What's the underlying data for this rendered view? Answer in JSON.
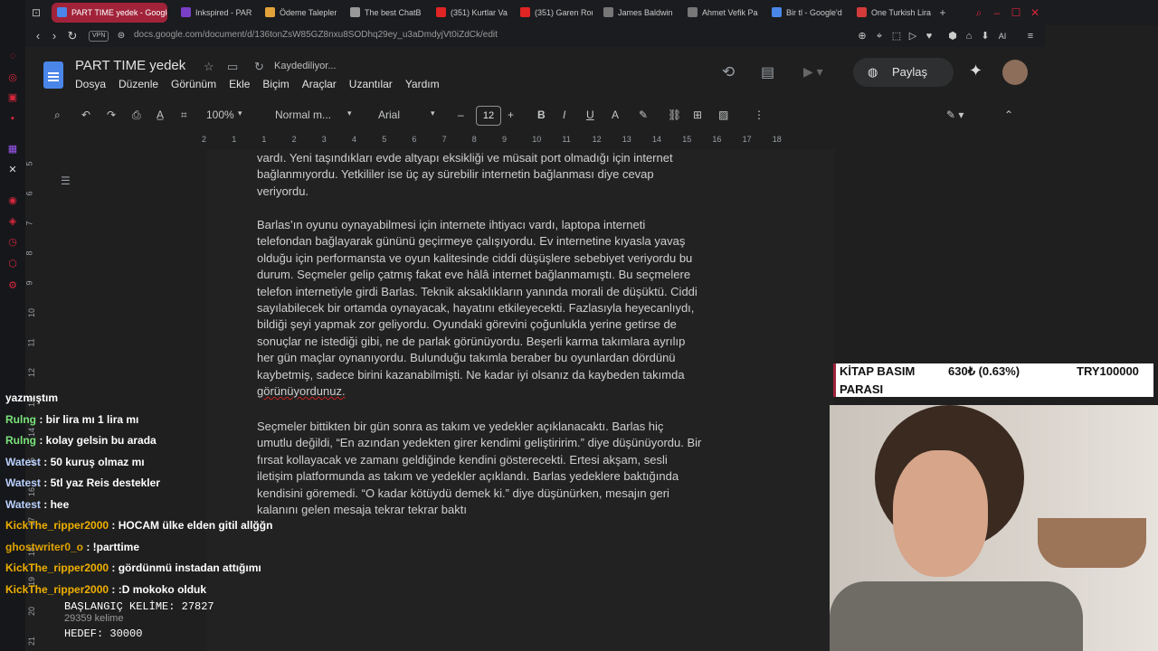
{
  "browser": {
    "tabs": [
      {
        "label": "PART TIME yedek - Google",
        "color": "#4a86e8",
        "active": true
      },
      {
        "label": "Inkspired - PAR",
        "color": "#7a3fc7",
        "active": false
      },
      {
        "label": "Ödeme Talepler",
        "color": "#e2a33a",
        "active": false
      },
      {
        "label": "The best ChatB",
        "color": "#999999",
        "active": false
      },
      {
        "label": "(351) Kurtlar Va",
        "color": "#e02424",
        "active": false
      },
      {
        "label": "(351) Garen Ron",
        "color": "#e02424",
        "active": false
      },
      {
        "label": "James Baldwin",
        "color": "#777777",
        "active": false
      },
      {
        "label": "Ahmet Vefik Pa",
        "color": "#777777",
        "active": false
      },
      {
        "label": "Bir tl - Google'd",
        "color": "#4a86e8",
        "active": false
      },
      {
        "label": "One Turkish Lira",
        "color": "#d33b3b",
        "active": false
      }
    ],
    "vpn": "VPN",
    "url": "docs.google.com/document/d/136tonZsW85GZ8nxu8SODhq29ey_u3aDmdyjVt0iZdCk/edit",
    "ai_label": "AI"
  },
  "docs": {
    "title": "PART TIME yedek",
    "saving": "Kaydediliyor...",
    "menu": [
      "Dosya",
      "Düzenle",
      "Görünüm",
      "Ekle",
      "Biçim",
      "Araçlar",
      "Uzantılar",
      "Yardım"
    ],
    "share_label": "Paylaş",
    "zoom": "100%",
    "style": "Normal m...",
    "font": "Arial",
    "font_size": "12",
    "ruler_top": [
      "2",
      "1",
      "1",
      "2",
      "3",
      "4",
      "5",
      "6",
      "7",
      "8",
      "9",
      "10",
      "11",
      "12",
      "13",
      "14",
      "15",
      "16",
      "17",
      "18"
    ],
    "ruler_left": [
      "5",
      "6",
      "7",
      "8",
      "9",
      "10",
      "11",
      "12",
      "13",
      "14",
      "15",
      "16",
      "17",
      "18",
      "19",
      "20",
      "21"
    ],
    "paragraphs": [
      [
        "vardı. Yeni taşındıkları evde altyapı eksikliği ve müsait port olmadığı için internet",
        "bağlanmıyordu. Yetkililer ise üç ay sürebilir internetin bağlanması diye cevap",
        "veriyordu."
      ],
      [
        "Barlas’ın oyunu oynayabilmesi için internete ihtiyacı vardı, laptopa interneti",
        "telefondan bağlayarak gününü geçirmeye çalışıyordu. Ev internetine kıyasla yavaş",
        "olduğu için performansta ve oyun kalitesinde ciddi düşüşlere sebebiyet veriyordu bu",
        "durum. Seçmeler gelip çatmış fakat eve hâlâ internet bağlanmamıştı. Bu seçmelere",
        "telefon internetiyle girdi Barlas. Teknik aksaklıkların yanında morali de düşüktü. Ciddi",
        "sayılabilecek bir ortamda oynayacak, hayatını etkileyecekti. Fazlasıyla heyecanlıydı,",
        "bildiği şeyi yapmak zor geliyordu. Oyundaki görevini çoğunlukla yerine getirse de",
        "sonuçlar ne istediği gibi, ne de parlak görünüyordu. Beşerli karma takımlara ayrılıp",
        "her gün maçlar oynanıyordu. Bulunduğu takımla beraber bu oyunlardan dördünü",
        "kaybetmiş, sadece birini kazanabilmişti. Ne kadar iyi olsanız da kaybeden takımda",
        "görünüyordunuz."
      ],
      [
        "Seçmeler bittikten bir gün sonra as takım ve yedekler açıklanacaktı. Barlas hiç",
        "umutlu değildi, “En azından yedekten girer kendimi geliştiririm.” diye düşünüyordu. Bir",
        "fırsat kollayacak ve zamanı geldiğinde kendini gösterecekti. Ertesi akşam, sesli",
        "iletişim platformunda as takım ve yedekler açıklandı. Barlas yedeklere baktığında",
        "kendisini göremedi. “O kadar kötüydü demek ki.” diye düşünürken, mesajın geri",
        "kalanını gelen mesaja tekrar tekrar baktı"
      ]
    ]
  },
  "chat": {
    "messages": [
      {
        "user": "",
        "text": "yazmıştım",
        "style": "plain"
      },
      {
        "user": "Rulng",
        "text": " : bir lira mı 1 lira mı",
        "style": "u1"
      },
      {
        "user": "Rulng",
        "text": " : kolay gelsin bu arada",
        "style": "u1"
      },
      {
        "user": "Watest",
        "text": " : 50 kuruş olmaz mı",
        "style": "u2"
      },
      {
        "user": "Watest",
        "text": " : 5tl yaz Reis destekler",
        "style": "u2"
      },
      {
        "user": "Watest",
        "text": " : hee",
        "style": "u2"
      },
      {
        "user": "KickThe_ripper2000",
        "text": " : HOCAM ülke elden gitil allğğn",
        "style": "u3"
      },
      {
        "user": "ghostwriter0_o",
        "text": " : !parttime",
        "style": "u4"
      },
      {
        "user": "KickThe_ripper2000",
        "text": " : gördünmü instadan attığımı",
        "style": "u3"
      },
      {
        "user": "KickThe_ripper2000",
        "text": " : :D mokoko olduk",
        "style": "u3"
      }
    ]
  },
  "word_counter": {
    "start": "BAŞLANGIÇ KELİME: 27827",
    "count": "29359 kelime",
    "target": "HEDEF: 30000"
  },
  "ticker": {
    "label_line1": "KİTAP BASIM",
    "label_line2": "PARASI",
    "amount": "630₺ (0.63%)",
    "goal": "TRY100000"
  }
}
